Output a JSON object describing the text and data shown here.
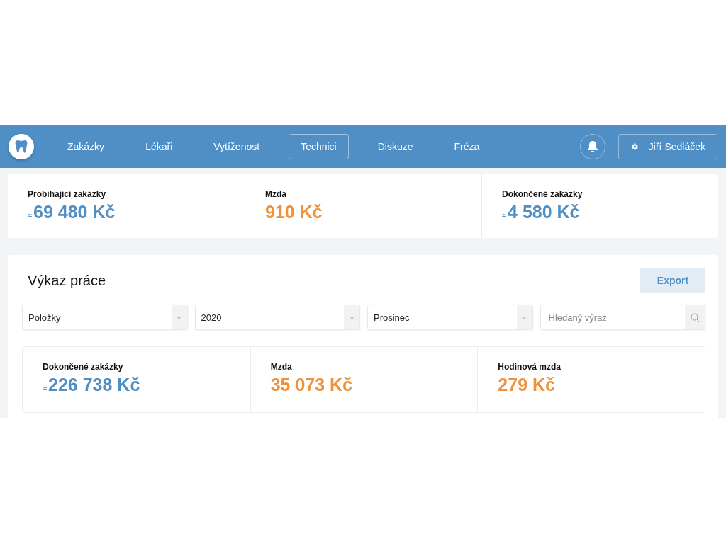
{
  "navbar": {
    "items": [
      {
        "label": "Zakázky",
        "selected": false
      },
      {
        "label": "Lékaři",
        "selected": false
      },
      {
        "label": "Vytíženost",
        "selected": false
      },
      {
        "label": "Technici",
        "selected": true
      },
      {
        "label": "Diskuze",
        "selected": false
      },
      {
        "label": "Fréza",
        "selected": false
      }
    ],
    "user": "Jiří Sedláček"
  },
  "summary": [
    {
      "label": "Probíhající zakázky",
      "approx": "≈",
      "value": "69 480 Kč",
      "color": "#4f8fc6"
    },
    {
      "label": "Mzda",
      "value": "910 Kč",
      "color": "#f0913a"
    },
    {
      "label": "Dokončené zakázky",
      "approx": "≈",
      "value": "4 580 Kč",
      "color": "#4f8fc6"
    }
  ],
  "report": {
    "title": "Výkaz práce",
    "export": "Export",
    "filters": [
      {
        "kind": "select",
        "value": "Položky"
      },
      {
        "kind": "select",
        "value": "2020"
      },
      {
        "kind": "select",
        "value": "Prosinec"
      },
      {
        "kind": "search",
        "placeholder": "Hledaný výraz"
      }
    ],
    "stats": [
      {
        "label": "Dokončené zakázky",
        "approx": "≈",
        "value": "226 738 Kč",
        "color": "#4f8fc6"
      },
      {
        "label": "Mzda",
        "value": "35 073 Kč",
        "color": "#f0913a"
      },
      {
        "label": "Hodinová mzda",
        "value": "279 Kč",
        "color": "#f0913a"
      }
    ]
  }
}
